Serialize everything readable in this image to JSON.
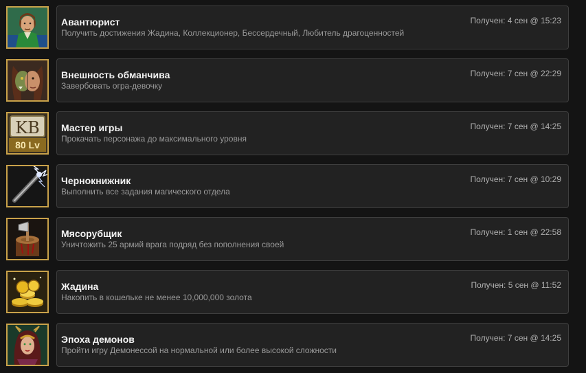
{
  "achievements": [
    {
      "icon": "adventurer-portrait-icon",
      "title": "Авантюрист",
      "description": "Получить достижения Жадина, Коллекционер, Бессердечный, Любитель драгоценностей",
      "date": "Получен: 4 сен @ 15:23"
    },
    {
      "icon": "ogre-girl-portrait-icon",
      "title": "Внешность обманчива",
      "description": "Завербовать огра-девочку",
      "date": "Получен: 7 сен @ 22:29"
    },
    {
      "icon": "level-80-badge-icon",
      "title": "Мастер игры",
      "description": "Прокачать персонажа до максимального уровня",
      "date": "Получен: 7 сен @ 14:25",
      "badge_letters": "KB",
      "badge_level": "80 Lv"
    },
    {
      "icon": "lightning-staff-icon",
      "title": "Чернокнижник",
      "description": "Выполнить все задания магического отдела",
      "date": "Получен: 7 сен @ 10:29"
    },
    {
      "icon": "chopping-block-axe-icon",
      "title": "Мясорубщик",
      "description": "Уничтожить 25 армий врага подряд без пополнения своей",
      "date": "Получен: 1 сен @ 22:58"
    },
    {
      "icon": "gold-coins-icon",
      "title": "Жадина",
      "description": "Накопить в кошельке не менее 10,000,000 золота",
      "date": "Получен: 5 сен @ 11:52"
    },
    {
      "icon": "demoness-portrait-icon",
      "title": "Эпоха демонов",
      "description": "Пройти игру Демонессой на нормальной или более высокой сложности",
      "date": "Получен: 7 сен @ 14:25"
    }
  ]
}
